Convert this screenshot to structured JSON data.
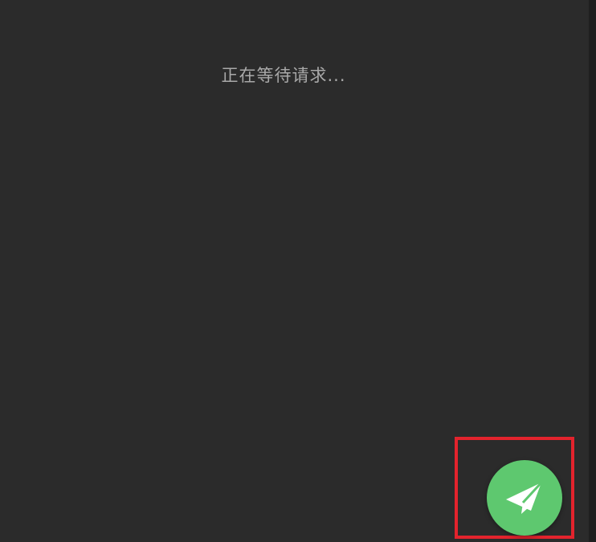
{
  "main": {
    "status_text": "正在等待请求..."
  },
  "fab": {
    "icon": "paper-plane-icon",
    "color": "#5ec86f",
    "icon_color": "#ffffff"
  },
  "highlight": {
    "color": "#e3232d"
  },
  "theme": {
    "background": "#2b2b2b",
    "text_color": "#a9a9a9"
  }
}
